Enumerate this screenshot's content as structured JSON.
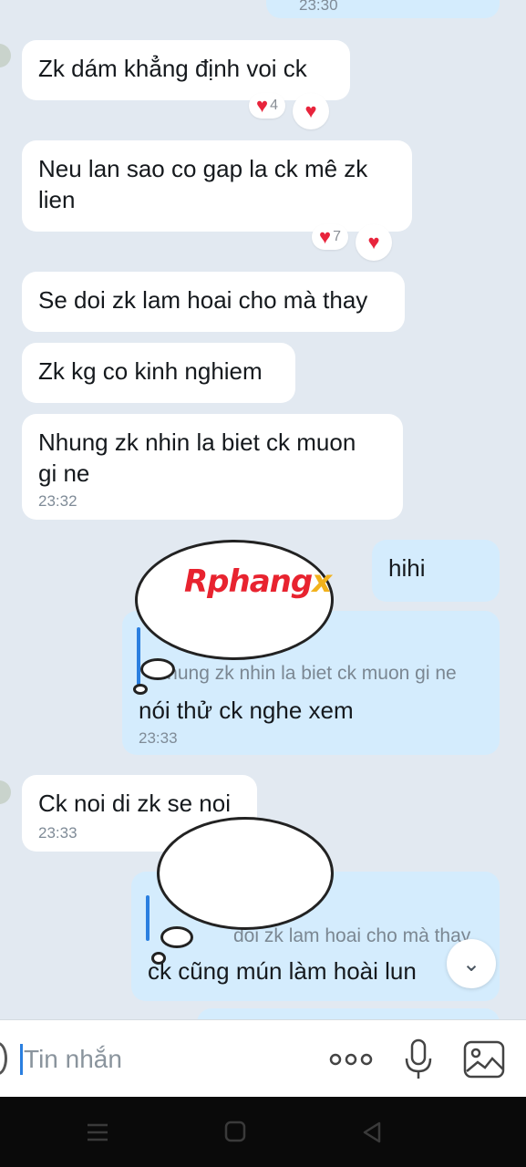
{
  "messages": {
    "top_time": "23:30",
    "m1": {
      "text": "Zk dám khẳng định voi ck",
      "reaction_count": "4"
    },
    "m2": {
      "text_l1": "Neu lan sao co gap la ck mê zk",
      "text_l2": "lien",
      "reaction_count": "7"
    },
    "m3": {
      "text": "Se doi zk lam hoai cho mà thay"
    },
    "m4": {
      "text": "Zk kg co kinh nghiem"
    },
    "m5": {
      "text_l1": "Nhung zk nhin la biet ck muon",
      "text_l2": "gi ne",
      "time": "23:32"
    },
    "m6": {
      "text": "hihi"
    },
    "m7": {
      "quote": "Nhung zk nhin la biet ck muon gi ne",
      "text": "nói thử ck nghe xem",
      "time": "23:33"
    },
    "m8": {
      "text": "Ck noi di zk se noi",
      "time": "23:33"
    },
    "m9": {
      "quote": "doi zk lam hoai cho mà thay",
      "text": "ck cũng mún làm hoài lun"
    }
  },
  "watermark": {
    "part1": "Rphang",
    "part2": "x",
    "color1": "#e8232f",
    "color2": "#3b6fe0",
    "color3": "#f2b21d"
  },
  "input": {
    "placeholder": "Tin nhắn",
    "more_icon": "more-dots-icon",
    "mic_icon": "microphone-icon",
    "image_icon": "image-icon"
  },
  "nav": {
    "menu_icon": "recent-apps-icon",
    "home_icon": "home-icon",
    "back_icon": "back-icon"
  },
  "colors": {
    "background": "#e2e9f1",
    "incoming": "#ffffff",
    "outgoing": "#d4ecfd",
    "heart": "#e8243c",
    "accent": "#2a7fe0"
  }
}
